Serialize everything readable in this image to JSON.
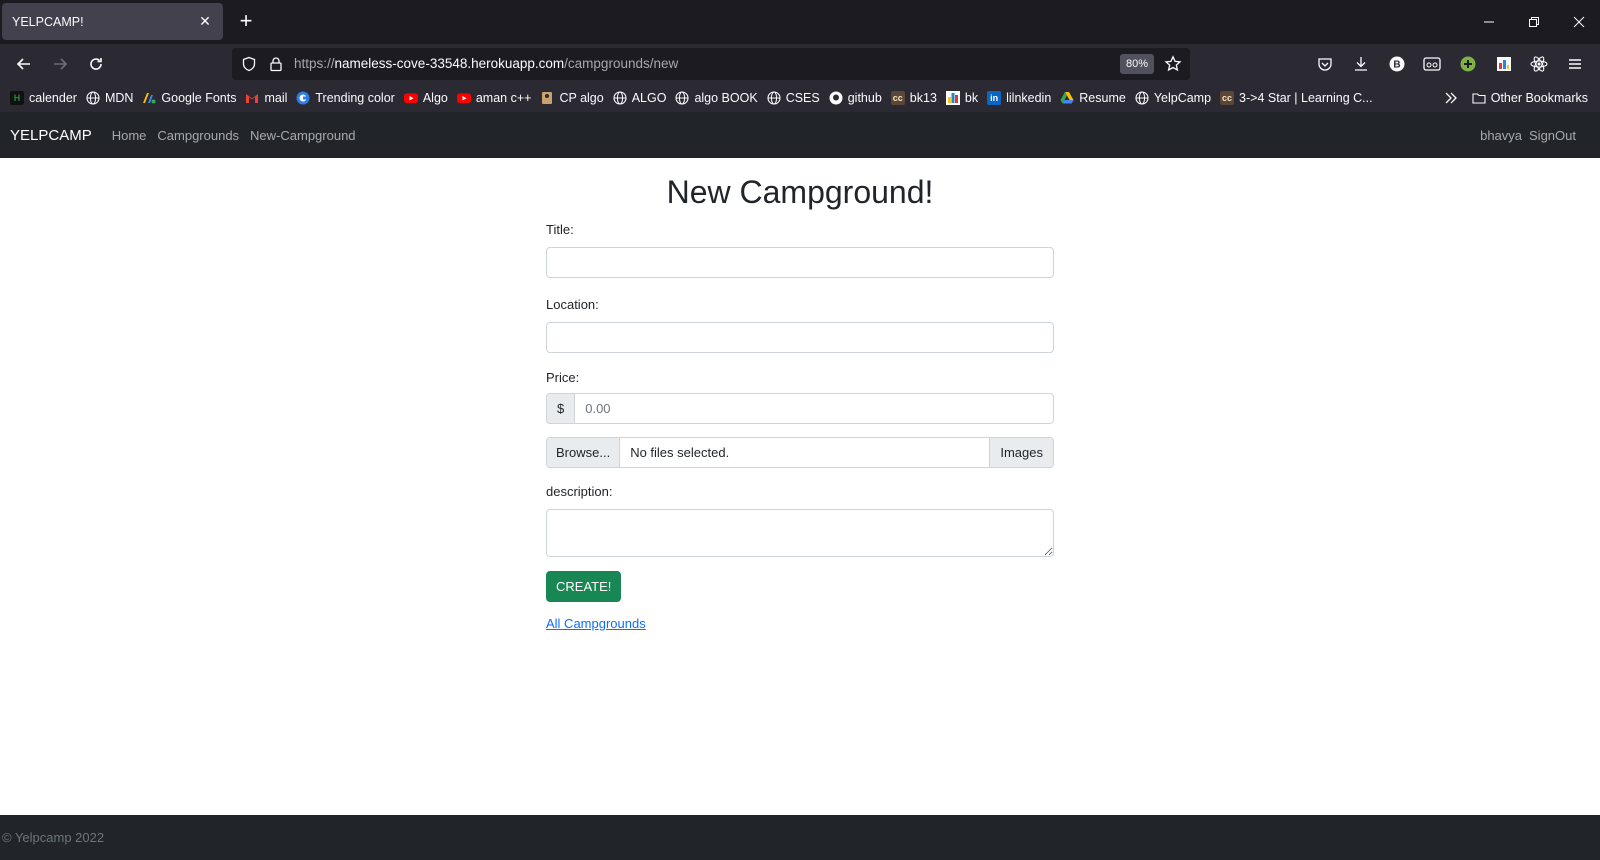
{
  "browser": {
    "tab_title": "YELPCAMP!",
    "url_scheme": "https://",
    "url_host": "nameless-cove-33548.herokuapp.com",
    "url_path": "/campgrounds/new",
    "zoom": "80%",
    "bookmarks": [
      {
        "label": "calender",
        "icon": "calendar-icon",
        "color": "#1e8e3e"
      },
      {
        "label": "MDN",
        "icon": "globe-icon",
        "color": "#fbfbfe"
      },
      {
        "label": "Google Fonts",
        "icon": "google-fonts-icon",
        "color": "#4285f4"
      },
      {
        "label": "mail",
        "icon": "gmail-icon",
        "color": "#ea4335"
      },
      {
        "label": "Trending color",
        "icon": "circle-c-icon",
        "color": "#2b7de9"
      },
      {
        "label": "Algo",
        "icon": "youtube-icon",
        "color": "#ff0000"
      },
      {
        "label": "aman c++",
        "icon": "youtube-icon",
        "color": "#ff0000"
      },
      {
        "label": "CP algo",
        "icon": "cp-algo-icon",
        "color": "#c9a26b"
      },
      {
        "label": "ALGO",
        "icon": "globe-icon",
        "color": "#fbfbfe"
      },
      {
        "label": "algo BOOK",
        "icon": "globe-icon",
        "color": "#fbfbfe"
      },
      {
        "label": "CSES",
        "icon": "globe-icon",
        "color": "#fbfbfe"
      },
      {
        "label": "github",
        "icon": "github-icon",
        "color": "#fbfbfe"
      },
      {
        "label": "bk13",
        "icon": "codechef-icon",
        "color": "#5b4638"
      },
      {
        "label": "bk",
        "icon": "codeforces-icon",
        "color": "#1f8acb"
      },
      {
        "label": "lilnkedin",
        "icon": "linkedin-icon",
        "color": "#0a66c2"
      },
      {
        "label": "Resume",
        "icon": "google-drive-icon",
        "color": "#34a853"
      },
      {
        "label": "YelpCamp",
        "icon": "globe-icon",
        "color": "#fbfbfe"
      },
      {
        "label": "3->4 Star | Learning C...",
        "icon": "codechef-icon",
        "color": "#5b4638"
      }
    ],
    "other_bookmarks": "Other Bookmarks"
  },
  "site_nav": {
    "brand": "YELPCAMP",
    "links": [
      "Home",
      "Campgrounds",
      "New-Campground"
    ],
    "user": "bhavya",
    "signout": "SignOut"
  },
  "form": {
    "heading": "New Campground!",
    "title_label": "Title:",
    "location_label": "Location:",
    "price_label": "Price:",
    "price_prefix": "$",
    "price_placeholder": "0.00",
    "browse_label": "Browse...",
    "file_status": "No files selected.",
    "images_label": "Images",
    "description_label": "description:",
    "submit_label": "CREATE!",
    "back_link": "All Campgrounds"
  },
  "footer": {
    "text": "© Yelpcamp 2022"
  }
}
